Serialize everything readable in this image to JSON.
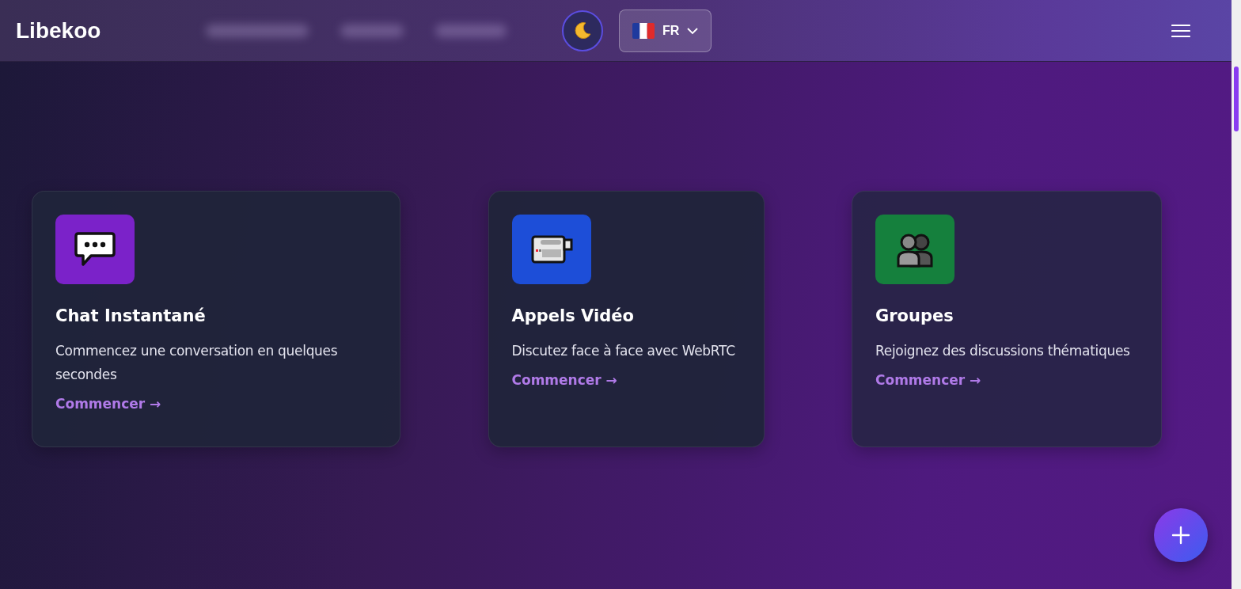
{
  "header": {
    "logo": "Libekoo",
    "language": {
      "code": "FR"
    }
  },
  "features": [
    {
      "kind": "chat",
      "color": "#7b22c9",
      "title": "Chat Instantané",
      "description": "Commencez une conversation en quelques secondes",
      "link": "Commencer →"
    },
    {
      "kind": "video",
      "color": "#1d4ed8",
      "title": "Appels Vidéo",
      "description": "Discutez face à face avec WebRTC",
      "link": "Commencer →"
    },
    {
      "kind": "group",
      "color": "#15803d",
      "title": "Groupes",
      "description": "Rejoignez des discussions thématiques",
      "link": "Commencer →"
    }
  ]
}
